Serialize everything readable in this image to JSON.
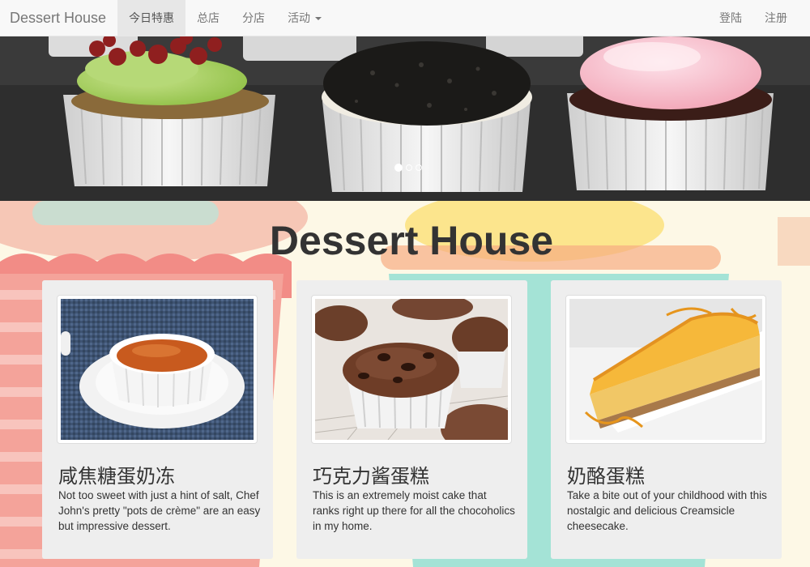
{
  "navbar": {
    "brand": "Dessert House",
    "items": [
      {
        "label": "今日特惠",
        "active": true
      },
      {
        "label": "总店",
        "active": false
      },
      {
        "label": "分店",
        "active": false
      },
      {
        "label": "活动",
        "active": false,
        "dropdown": true
      }
    ],
    "right_items": [
      {
        "label": "登陆"
      },
      {
        "label": "注册"
      }
    ]
  },
  "carousel": {
    "slide_count": 3,
    "active_index": 0
  },
  "hero": {
    "title": "Dessert House"
  },
  "cards": [
    {
      "title": "咸焦糖蛋奶冻",
      "text": "Not too sweet with just a hint of salt, Chef John's pretty \"pots de crème\" are an easy but impressive dessert."
    },
    {
      "title": "巧克力酱蛋糕",
      "text": "This is an extremely moist cake that ranks right up there for all the chocoholics in my home."
    },
    {
      "title": "奶酪蛋糕",
      "text": "Take a bite out of your childhood with this nostalgic and delicious Creamsicle cheesecake."
    }
  ],
  "colors": {
    "navbar_bg": "#f8f8f8",
    "active_nav_bg": "#e7e7e7",
    "page_bg": "#fffbe8",
    "card_bg": "#eeeeee",
    "text_dark": "#333333"
  }
}
